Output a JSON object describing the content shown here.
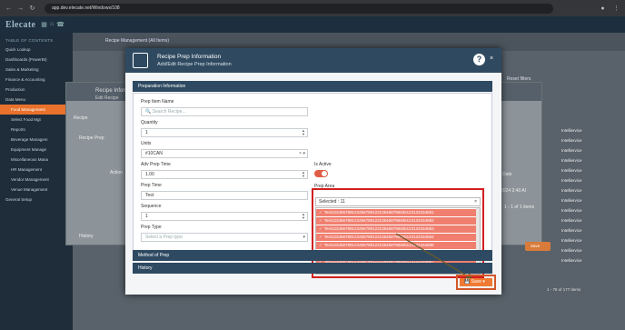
{
  "browser": {
    "url": "app.dev.elecate.net/Windows/108"
  },
  "app": {
    "logo": "Elecate"
  },
  "sidebar": {
    "toc_label": "TABLE OF CONTENTS",
    "items": [
      {
        "label": "Quick Lookup"
      },
      {
        "label": "Dashboards (PowerBI)"
      },
      {
        "label": "Sales & Marketing"
      },
      {
        "label": "Finance & Accounting"
      },
      {
        "label": "Production"
      },
      {
        "label": "Data Menu"
      },
      {
        "label": "Food Management"
      },
      {
        "label": "Select Food Mgt"
      },
      {
        "label": "Reports"
      },
      {
        "label": "Beverage Managem"
      },
      {
        "label": "Equipment Manage"
      },
      {
        "label": "Miscellaneous Mana"
      },
      {
        "label": "HR Management"
      },
      {
        "label": "Vendor Management"
      },
      {
        "label": "Venue Management"
      },
      {
        "label": "General Setup"
      }
    ]
  },
  "background": {
    "page_title": "Recipe Management (All Items)",
    "mid_title": "Recipe Information",
    "mid_subtitle": "Edit Recipe",
    "tab_recipe": "Recipe",
    "tab_recipe_prep": "Recipe Prep",
    "col_action": "Action",
    "col_date": "Date",
    "row_date": "2024 2:40 Al",
    "items_count": "1 - 1 of 1 items",
    "history": "History",
    "save_label": "Save",
    "reset_filters": "Reset filters",
    "pager_text": "1 - 78 of 177 items",
    "right_col": [
      "Intelliervice",
      "Intelliervice",
      "Intelliervice",
      "Intelliervice",
      "Intelliervice",
      "Intelliervice",
      "Intelliervice",
      "Intelliervice",
      "Intelliervice",
      "Intelliervice",
      "Intelliervice",
      "Intelliervice",
      "Intelliervice",
      "Intelliervice"
    ]
  },
  "modal": {
    "title": "Recipe Prep Information",
    "subtitle": "Add/Edit Recipe Prep Information",
    "section_prep_info": "Preparation Information",
    "section_method": "Method of Prep",
    "section_history": "History",
    "save_label": "Save",
    "fields": {
      "prep_item_name_label": "Prep Item Name",
      "search_placeholder": "Search Recipe...",
      "quantity_label": "Quantity",
      "quantity_value": "1",
      "units_label": "Units",
      "units_value": "#10CAN",
      "adv_prep_time_label": "Adv Prep Time",
      "adv_prep_time_value": "1.00",
      "prep_time_label": "Prep Time",
      "prep_time_value": "Test",
      "sequence_label": "Sequence",
      "sequence_value": "1",
      "prep_type_label": "Prep Type",
      "prep_type_placeholder": "Select a Prep type",
      "is_active_label": "Is Active",
      "prep_area_label": "Prep Area",
      "selected_text": "Selected : 11"
    },
    "prep_area_items": [
      "Test123456789123456789123135468798465123132164681",
      "Test123456789123456789123135468798465123132164682",
      "Test123456789123456789123135468798465123132164683",
      "Test123456789123456789123135468798465123132164684",
      "Test123456789123456789123135468798465123132164685",
      "Test123456789123456789123135468798465123132164686",
      "Test123456789123456789123135468798465123132164687",
      "Test123456789123456789123135468798465123132164688"
    ]
  },
  "colors": {
    "header": "#2f4a60",
    "accent": "#f07a33",
    "highlight": "#d21f1f"
  }
}
